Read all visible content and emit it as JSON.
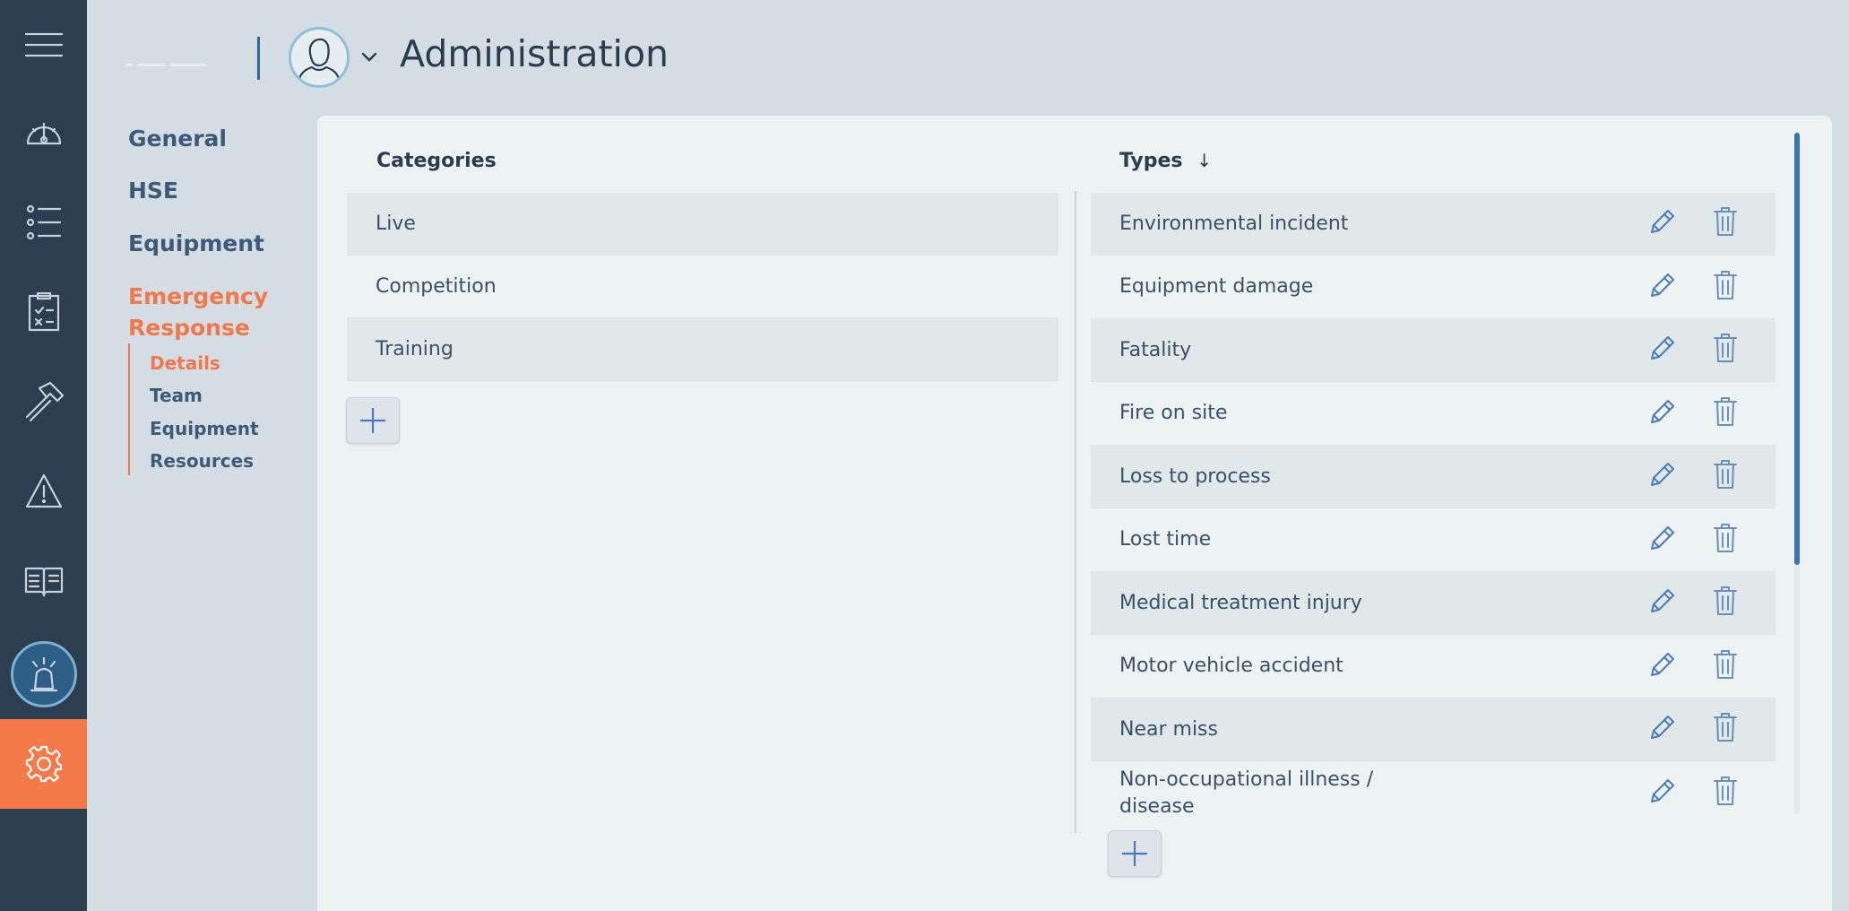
{
  "header": {
    "title": "Administration"
  },
  "rail": {
    "items": [
      {
        "icon": "menu-icon"
      },
      {
        "icon": "dashboard-gauge-icon"
      },
      {
        "icon": "list-icon"
      },
      {
        "icon": "checklist-clipboard-icon"
      },
      {
        "icon": "hammer-icon"
      },
      {
        "icon": "warning-icon"
      },
      {
        "icon": "book-icon"
      },
      {
        "icon": "siren-icon",
        "active": true
      },
      {
        "icon": "gear-icon",
        "highlight": true
      }
    ]
  },
  "sidenav": {
    "items": [
      {
        "label": "General"
      },
      {
        "label": "HSE"
      },
      {
        "label": "Equipment"
      },
      {
        "label": "Emergency Response",
        "active": true
      }
    ],
    "subitems": [
      {
        "label": "Details",
        "active": true
      },
      {
        "label": "Team"
      },
      {
        "label": "Equipment"
      },
      {
        "label": "Resources"
      }
    ]
  },
  "categories": {
    "header": "Categories",
    "rows": [
      {
        "label": "Live"
      },
      {
        "label": "Competition"
      },
      {
        "label": "Training"
      }
    ]
  },
  "types": {
    "header": "Types",
    "sort_indicator": "↓",
    "rows": [
      {
        "label": "Environmental incident"
      },
      {
        "label": "Equipment damage"
      },
      {
        "label": "Fatality"
      },
      {
        "label": "Fire on site"
      },
      {
        "label": "Loss to process"
      },
      {
        "label": "Lost time"
      },
      {
        "label": "Medical treatment injury"
      },
      {
        "label": "Motor vehicle accident"
      },
      {
        "label": "Near miss"
      },
      {
        "label": "Non-occupational illness / disease"
      }
    ]
  },
  "colors": {
    "rail": "#2c3e4f",
    "accent": "#f47a4a",
    "link": "#3d5a78",
    "action": "#4a7bb5"
  }
}
